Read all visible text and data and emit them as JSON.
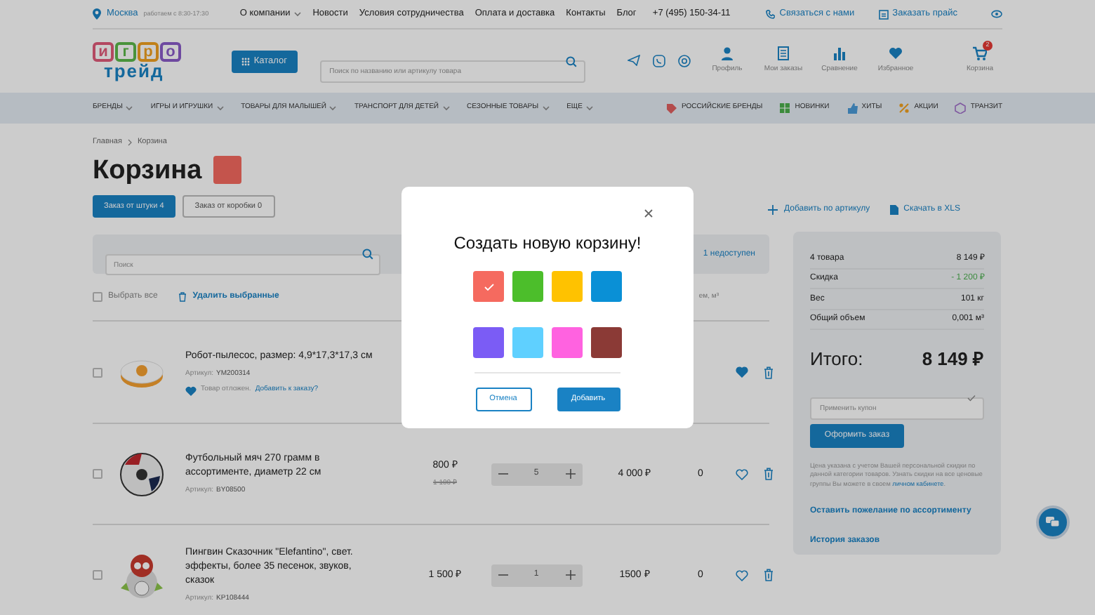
{
  "top_bar": {
    "city": "Москва",
    "hours": "работаем с 8:30-17:30",
    "menu": [
      {
        "label": "О компании",
        "dropdown": true
      },
      {
        "label": "Новости",
        "dropdown": false
      },
      {
        "label": "Условия сотрудничества",
        "dropdown": false
      },
      {
        "label": "Оплата и доставка",
        "dropdown": false
      },
      {
        "label": "Контакты",
        "dropdown": false
      },
      {
        "label": "Блог",
        "dropdown": false
      }
    ],
    "phone": "+7 (495) 150-34-11",
    "links": [
      {
        "label": "Связаться с нами",
        "kind": "contact"
      },
      {
        "label": "Заказать прайс",
        "kind": "price"
      }
    ]
  },
  "header": {
    "logo": {
      "letters": [
        "и",
        "г",
        "р",
        "о"
      ],
      "word": "трейд"
    },
    "catalog_button": "Каталог",
    "search": {
      "placeholder": "Поиск по названию или артикулу товара"
    },
    "social": [
      {
        "kind": "telegram"
      },
      {
        "kind": "whatsapp"
      },
      {
        "kind": "email"
      }
    ],
    "nav_icons": [
      {
        "label": "Профиль",
        "kind": "profile"
      },
      {
        "label": "Мои заказы",
        "kind": "orders"
      },
      {
        "label": "Сравнение",
        "kind": "compare"
      },
      {
        "label": "Избранное",
        "kind": "favorites"
      },
      {
        "label": "Корзина",
        "kind": "cart",
        "badge": "2"
      }
    ]
  },
  "nav": {
    "categories": [
      {
        "label": "БРЕНДЫ"
      },
      {
        "label": "ИГРЫ И ИГРУШКИ"
      },
      {
        "label": "ТОВАРЫ ДЛЯ МАЛЫШЕЙ"
      },
      {
        "label": "ТРАНСПОРТ ДЛЯ ДЕТЕЙ"
      },
      {
        "label": "СЕЗОННЫЕ ТОВАРЫ"
      },
      {
        "label": "ЕЩЕ"
      }
    ],
    "special": [
      {
        "label": "РОССИЙСКИЕ БРЕНДЫ",
        "kind": "brands"
      },
      {
        "label": "НОВИНКИ",
        "kind": "new"
      },
      {
        "label": "ХИТЫ",
        "kind": "hits"
      },
      {
        "label": "АКЦИИ",
        "kind": "sale"
      },
      {
        "label": "ТРАНЗИТ",
        "kind": "transit"
      }
    ]
  },
  "breadcrumbs": [
    "Главная",
    "Корзина"
  ],
  "page_title": "Корзина",
  "tabs": [
    {
      "label": "Заказ от штуки 4",
      "selected": true
    },
    {
      "label": "Заказ  от коробки 0",
      "selected": false
    }
  ],
  "actions": [
    {
      "label": "Добавить по артикулу",
      "kind": "add"
    },
    {
      "label": "Скачать в XLS",
      "kind": "xls"
    }
  ],
  "cart_search": {
    "placeholder": "Поиск"
  },
  "unavailable": "1 недоступен",
  "select_all": {
    "label": "Выбрать все",
    "checked": false
  },
  "delete_selected": "Удалить выбранные",
  "column_header_fragment": "ем, м³",
  "items": [
    {
      "name": "Робот-пылесос, размер: 4,9*17,3*17,3 см",
      "article_label": "Артикул:",
      "article": "YM200314",
      "note": "Товар отложен.",
      "note_link": "Добавить к заказу?",
      "favorite": true,
      "checked": false
    },
    {
      "name": "Футбольный мяч 270 грамм в ассортименте, диаметр 22 см",
      "article_label": "Артикул:",
      "article": "BY08500",
      "price": "800 ₽",
      "old_price": "1 100 ₽",
      "quantity": "5",
      "sum": "4 000 ₽",
      "volume": "0",
      "favorite": false,
      "checked": false
    },
    {
      "name": "Пингвин Сказочник \"Elefantino\", свет. эффекты, более 35 песенок, звуков, сказок",
      "article_label": "Артикул:",
      "article": "KP108444",
      "price": "1 500 ₽",
      "quantity": "1",
      "sum": "1500 ₽",
      "volume": "0",
      "favorite": false,
      "checked": false
    }
  ],
  "summary": {
    "rows": [
      {
        "label": "4 товара",
        "value": "8 149 ₽",
        "kind": "plain"
      },
      {
        "label": "Скидка",
        "value": "- 1 200 ₽",
        "kind": "discount"
      },
      {
        "label": "Вес",
        "value": "101 кг",
        "kind": "plain"
      },
      {
        "label": "Общий объем",
        "value": "0,001 м³",
        "kind": "plain"
      }
    ],
    "total_label": "Итого:",
    "total_value": "8 149 ₽",
    "coupon": {
      "placeholder": "Применить купон"
    },
    "order_button": "Оформить заказ",
    "note": "Цена указана с учетом Вашей персональной скидки по данной категории  товаров. Узнать скидки на все ценовые группы Вы можете в своем",
    "note_link": "личном кабинете",
    "note_end": ".",
    "links": [
      "Оставить пожелание по ассортименту",
      "История заказов"
    ]
  },
  "modal": {
    "title": "Создать новую корзину!",
    "colors": [
      {
        "color": "#f56a5f",
        "selected": true
      },
      {
        "color": "#4cbe2b",
        "selected": false
      },
      {
        "color": "#ffc200",
        "selected": false
      },
      {
        "color": "#0a90d6",
        "selected": false
      },
      {
        "color": "#7b5cf5",
        "selected": false
      },
      {
        "color": "#5fd0ff",
        "selected": false
      },
      {
        "color": "#ff62e0",
        "selected": false
      },
      {
        "color": "#8b3a36",
        "selected": false
      }
    ],
    "cancel": "Отмена",
    "confirm": "Добавить"
  }
}
